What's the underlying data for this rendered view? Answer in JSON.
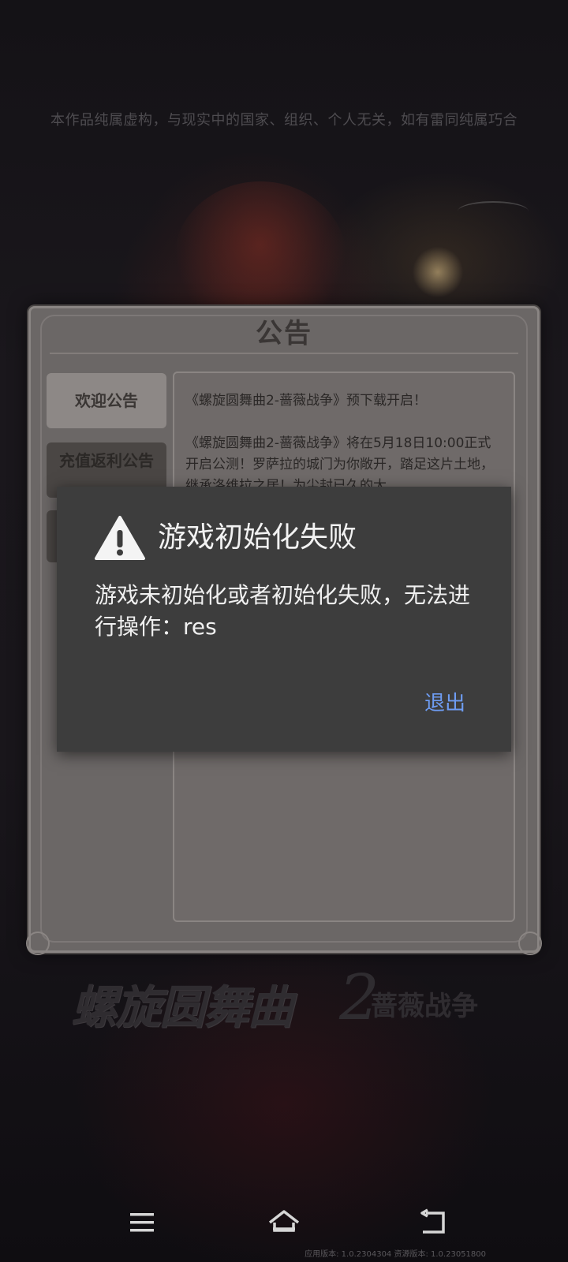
{
  "disclaimer": "本作品纯属虚构，与现实中的国家、组织、个人无关，如有雷同纯属巧合",
  "announcement": {
    "title": "公告",
    "tabs": [
      {
        "label": "欢迎公告",
        "active": true
      },
      {
        "label": "充值返利公告",
        "active": false
      },
      {
        "label": "",
        "active": false
      }
    ],
    "content": [
      "《螺旋圆舞曲2-蔷薇战争》预下载开启！",
      "《螺旋圆舞曲2-蔷薇战争》将在5月18日10:00正式开启公测！罗萨拉的城门为你敞开，踏足这片土地，继承洛维拉之居！为尘封已久的大"
    ]
  },
  "logo": {
    "main": "螺旋圆舞曲",
    "number": "2",
    "sub": "蔷薇战争"
  },
  "dialog": {
    "icon": "warning-icon",
    "title": "游戏初始化失败",
    "message": "游戏未初始化或者初始化失败，无法进行操作：res",
    "exit_label": "退出",
    "accent_color": "#6e9cf2"
  },
  "navbar": {
    "menu_icon": "menu-icon",
    "home_icon": "home-icon",
    "back_icon": "back-icon"
  },
  "version": "应用版本: 1.0.2304304  资源版本: 1.0.23051800"
}
